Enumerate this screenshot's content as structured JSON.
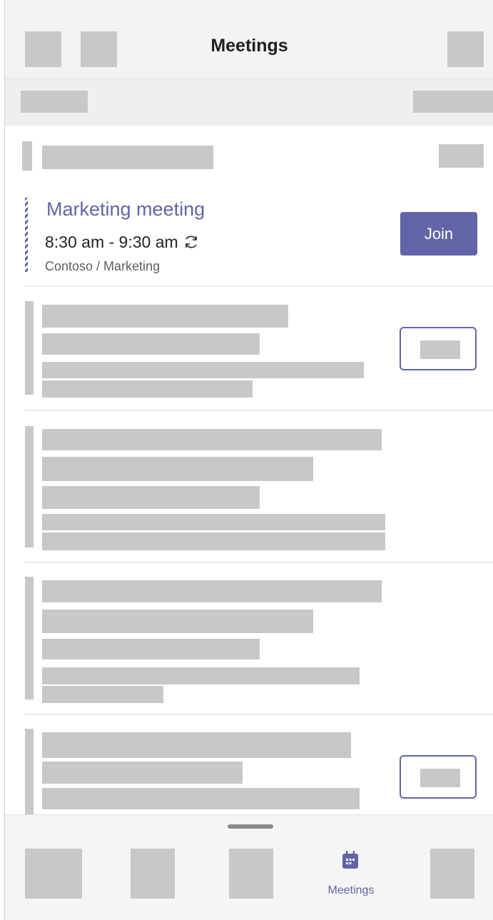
{
  "header": {
    "title": "Meetings"
  },
  "meeting": {
    "title": "Marketing meeting",
    "time": "8:30 am - 9:30 am",
    "channel": "Contoso / Marketing",
    "join_label": "Join"
  },
  "nav": {
    "meetings_label": "Meetings"
  },
  "colors": {
    "accent": "#6264a7",
    "placeholder": "#c8c8c8"
  }
}
